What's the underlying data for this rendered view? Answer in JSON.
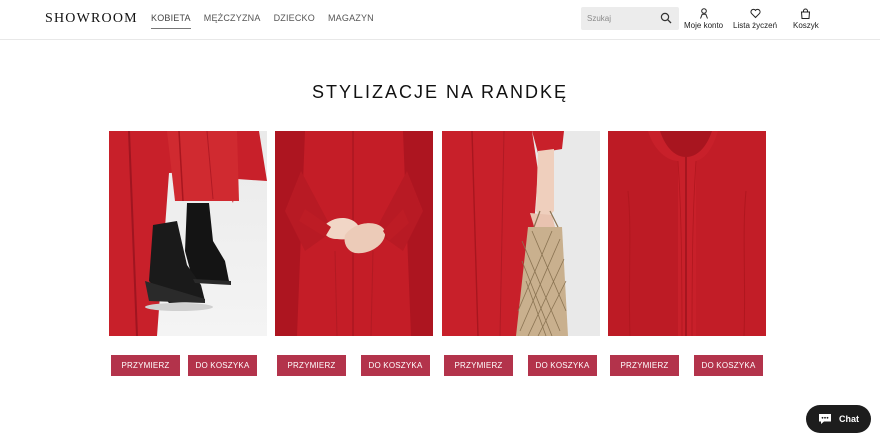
{
  "header": {
    "logo": "SHOWROOM",
    "nav": [
      {
        "label": "KOBIETA",
        "active": true
      },
      {
        "label": "MĘŻCZYZNA",
        "active": false
      },
      {
        "label": "DZIECKO",
        "active": false
      },
      {
        "label": "MAGAZYN",
        "active": false
      }
    ],
    "search_placeholder": "Szukaj",
    "account_label": "Moje konto",
    "wishlist_label": "Lista życzeń",
    "cart_label": "Koszyk"
  },
  "main": {
    "title": "STYLIZACJE NA RANDKĘ",
    "cards": [
      {
        "try_label": "PRZYMIERZ",
        "cart_label": "DO KOSZYKA",
        "image": "boots-photo"
      },
      {
        "try_label": "PRZYMIERZ",
        "cart_label": "DO KOSZYKA",
        "image": "hands-coat-photo"
      },
      {
        "try_label": "PRZYMIERZ",
        "cart_label": "DO KOSZYKA",
        "image": "net-bag-photo"
      },
      {
        "try_label": "PRZYMIERZ",
        "cart_label": "DO KOSZYKA",
        "image": "collar-detail-photo"
      }
    ]
  },
  "chat": {
    "label": "Chat"
  },
  "colors": {
    "accent": "#b3334b",
    "garment_red": "#c8202a",
    "chat_bg": "#1d1d1d"
  }
}
